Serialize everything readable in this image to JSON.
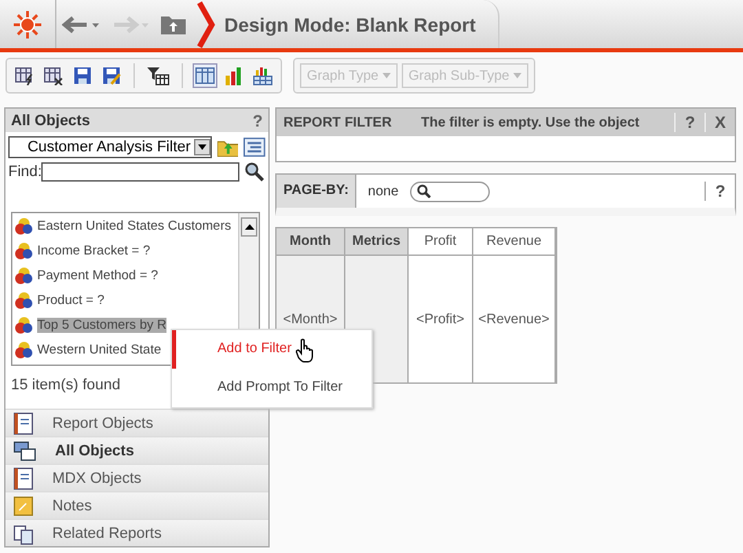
{
  "header": {
    "title": "Design Mode: Blank Report"
  },
  "toolbar": {
    "graph_type": "Graph Type",
    "graph_sub_type": "Graph Sub-Type"
  },
  "objects_panel": {
    "title": "All Objects",
    "help": "?",
    "folder": "Customer Analysis Filter",
    "find_label": "Find:",
    "items": [
      {
        "label": "Eastern United States Customers",
        "selected": false
      },
      {
        "label": "Income Bracket = ?",
        "selected": false
      },
      {
        "label": "Payment Method = ?",
        "selected": false
      },
      {
        "label": "Product = ?",
        "selected": false
      },
      {
        "label": "Top 5 Customers by R",
        "selected": true
      },
      {
        "label": "Western United State",
        "selected": false
      }
    ],
    "count": "15 item(s) found",
    "nav": [
      {
        "label": "Report Objects",
        "kind": "book",
        "selected": false
      },
      {
        "label": "All Objects",
        "kind": "stack",
        "selected": true
      },
      {
        "label": "MDX Objects",
        "kind": "book",
        "selected": false
      },
      {
        "label": "Notes",
        "kind": "note",
        "selected": false
      },
      {
        "label": "Related Reports",
        "kind": "pages",
        "selected": false
      }
    ]
  },
  "context_menu": [
    {
      "label": "Add to Filter",
      "selected": true
    },
    {
      "label": "Add Prompt To Filter",
      "selected": false
    }
  ],
  "report_filter": {
    "title": "REPORT FILTER",
    "message": "The filter is empty. Use the object",
    "help": "?",
    "close": "X"
  },
  "page_by": {
    "label": "PAGE-BY:",
    "value": "none",
    "help": "?"
  },
  "grid": {
    "headers": [
      {
        "label": "Month",
        "kind": "attribute"
      },
      {
        "label": "Metrics",
        "kind": "attribute"
      },
      {
        "label": "Profit",
        "kind": "metric"
      },
      {
        "label": "Revenue",
        "kind": "metric"
      }
    ],
    "cells": [
      "<Month>",
      "",
      "<Profit>",
      "<Revenue>"
    ]
  }
}
